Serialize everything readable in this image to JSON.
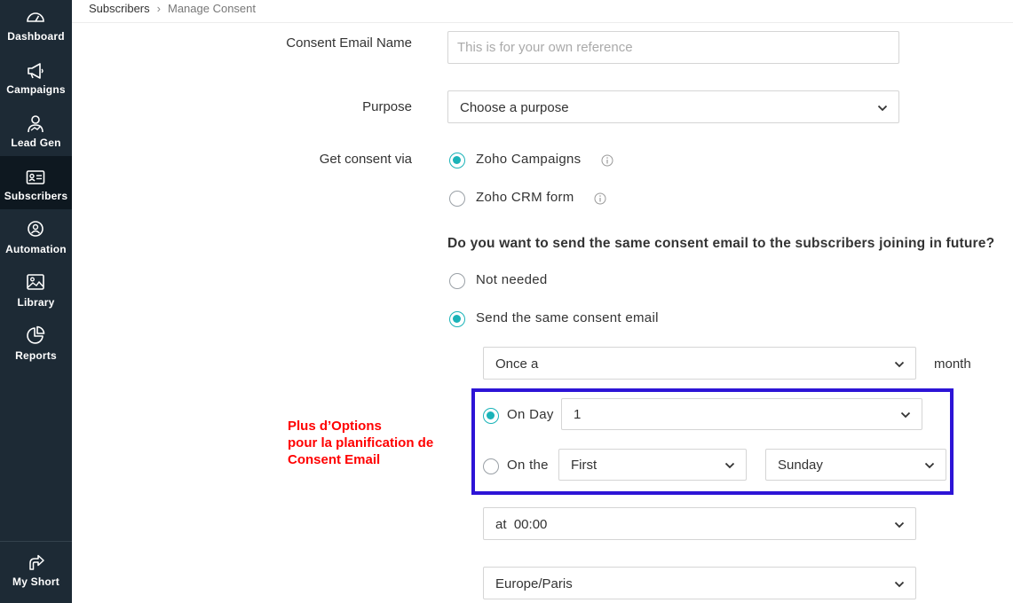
{
  "sidebar": {
    "items": [
      {
        "label": "Dashboard",
        "icon": "dashboard-icon"
      },
      {
        "label": "Campaigns",
        "icon": "megaphone-icon"
      },
      {
        "label": "Lead Gen",
        "icon": "lead-gen-icon"
      },
      {
        "label": "Subscribers",
        "icon": "id-card-icon",
        "active": true
      },
      {
        "label": "Automation",
        "icon": "automation-icon"
      },
      {
        "label": "Library",
        "icon": "image-icon"
      },
      {
        "label": "Reports",
        "icon": "pie-chart-icon"
      }
    ],
    "bottom": {
      "label": "My Short",
      "icon": "shortcut-icon"
    }
  },
  "breadcrumb": {
    "parent": "Subscribers",
    "separator": "›",
    "current": "Manage Consent"
  },
  "form": {
    "consent_email_name": {
      "label": "Consent Email Name",
      "placeholder": "This is for your own reference",
      "value": ""
    },
    "purpose": {
      "label": "Purpose",
      "selected": "Choose a purpose"
    },
    "get_consent_via": {
      "label": "Get consent via",
      "options": [
        {
          "label": "Zoho Campaigns",
          "checked": true
        },
        {
          "label": "Zoho CRM form",
          "checked": false
        }
      ]
    },
    "future_question": "Do you want to send the same consent email to the subscribers joining in future?",
    "future_options": [
      {
        "label": "Not needed",
        "checked": false
      },
      {
        "label": "Send the same consent email",
        "checked": true
      }
    ],
    "schedule": {
      "frequency": "Once a",
      "frequency_unit": "month",
      "on_day": {
        "label": "On Day",
        "value": "1",
        "checked": true
      },
      "on_the": {
        "label": "On the",
        "week": "First",
        "weekday": "Sunday",
        "checked": false
      },
      "time": "at  00:00",
      "timezone": "Europe/Paris"
    }
  },
  "annotation": {
    "lines": [
      "Plus d’Options",
      "pour la planification de",
      "Consent Email"
    ],
    "color": "#ff0000"
  },
  "colors": {
    "accent": "#1ab3b8",
    "sidebar": "#1d2a35",
    "highlight": "#2d14d6"
  }
}
